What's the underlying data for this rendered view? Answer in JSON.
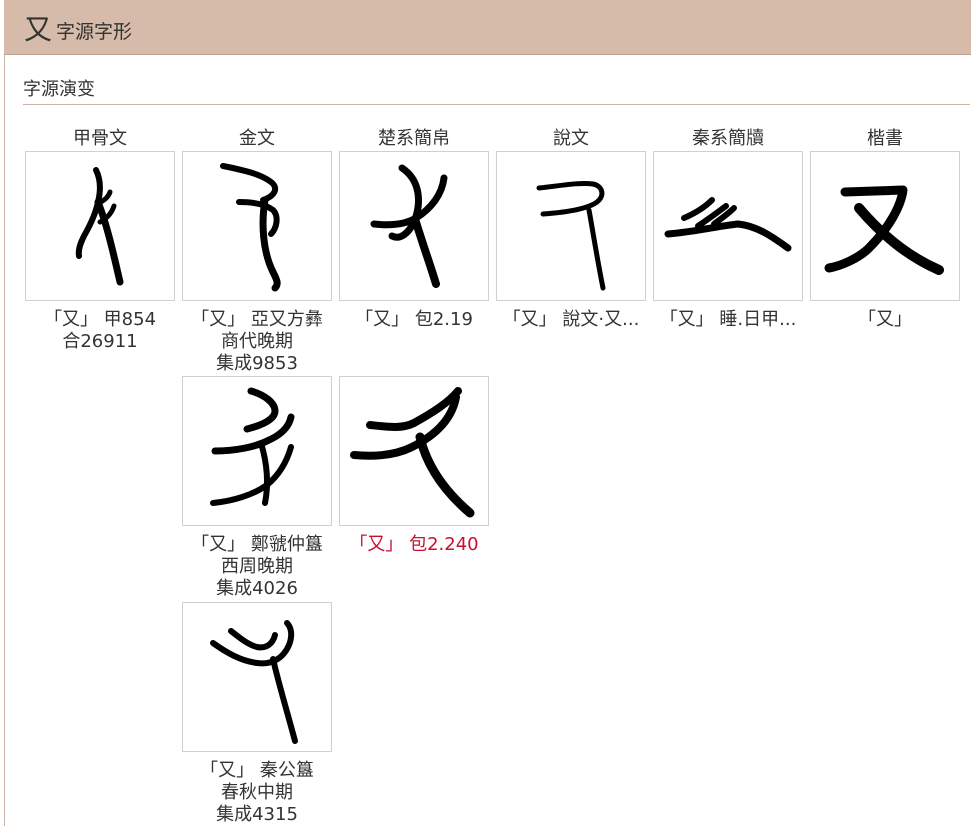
{
  "header": {
    "char": "又",
    "title": "字源字形"
  },
  "section": {
    "title": "字源演变"
  },
  "columns": [
    "甲骨文",
    "金文",
    "楚系簡帛",
    "說文",
    "秦系簡牘",
    "楷書"
  ],
  "tiles": [
    {
      "glyph": "oracle-you-glyph",
      "caption": [
        "「又」 甲854",
        "合26911"
      ]
    },
    {
      "glyph": "bronze-you-glyph-1",
      "caption": [
        "「又」 亞又方彝",
        "商代晚期",
        "集成9853"
      ]
    },
    {
      "glyph": "chu-you-glyph-1",
      "caption": [
        "「又」 包2.19"
      ]
    },
    {
      "glyph": "shuowen-you-glyph",
      "caption": [
        "「又」 說文·又..."
      ]
    },
    {
      "glyph": "qin-you-glyph",
      "caption": [
        "「又」 睡.日甲..."
      ]
    },
    {
      "glyph": "kaishu-you-glyph",
      "caption": [
        "「又」"
      ]
    },
    {
      "glyph": "bronze-you-glyph-2",
      "caption": [
        "「又」 鄭虢仲簋",
        "西周晚期",
        "集成4026"
      ]
    },
    {
      "glyph": "chu-you-glyph-2",
      "caption": [
        "「又」 包2.240"
      ],
      "highlight": true
    },
    {
      "glyph": "bronze-you-glyph-3",
      "caption": [
        "「又」 秦公簋",
        "春秋中期",
        "集成4315"
      ]
    }
  ],
  "colors": {
    "header_bg": "#d6bbaa",
    "highlight_caption": "#c8102e"
  }
}
